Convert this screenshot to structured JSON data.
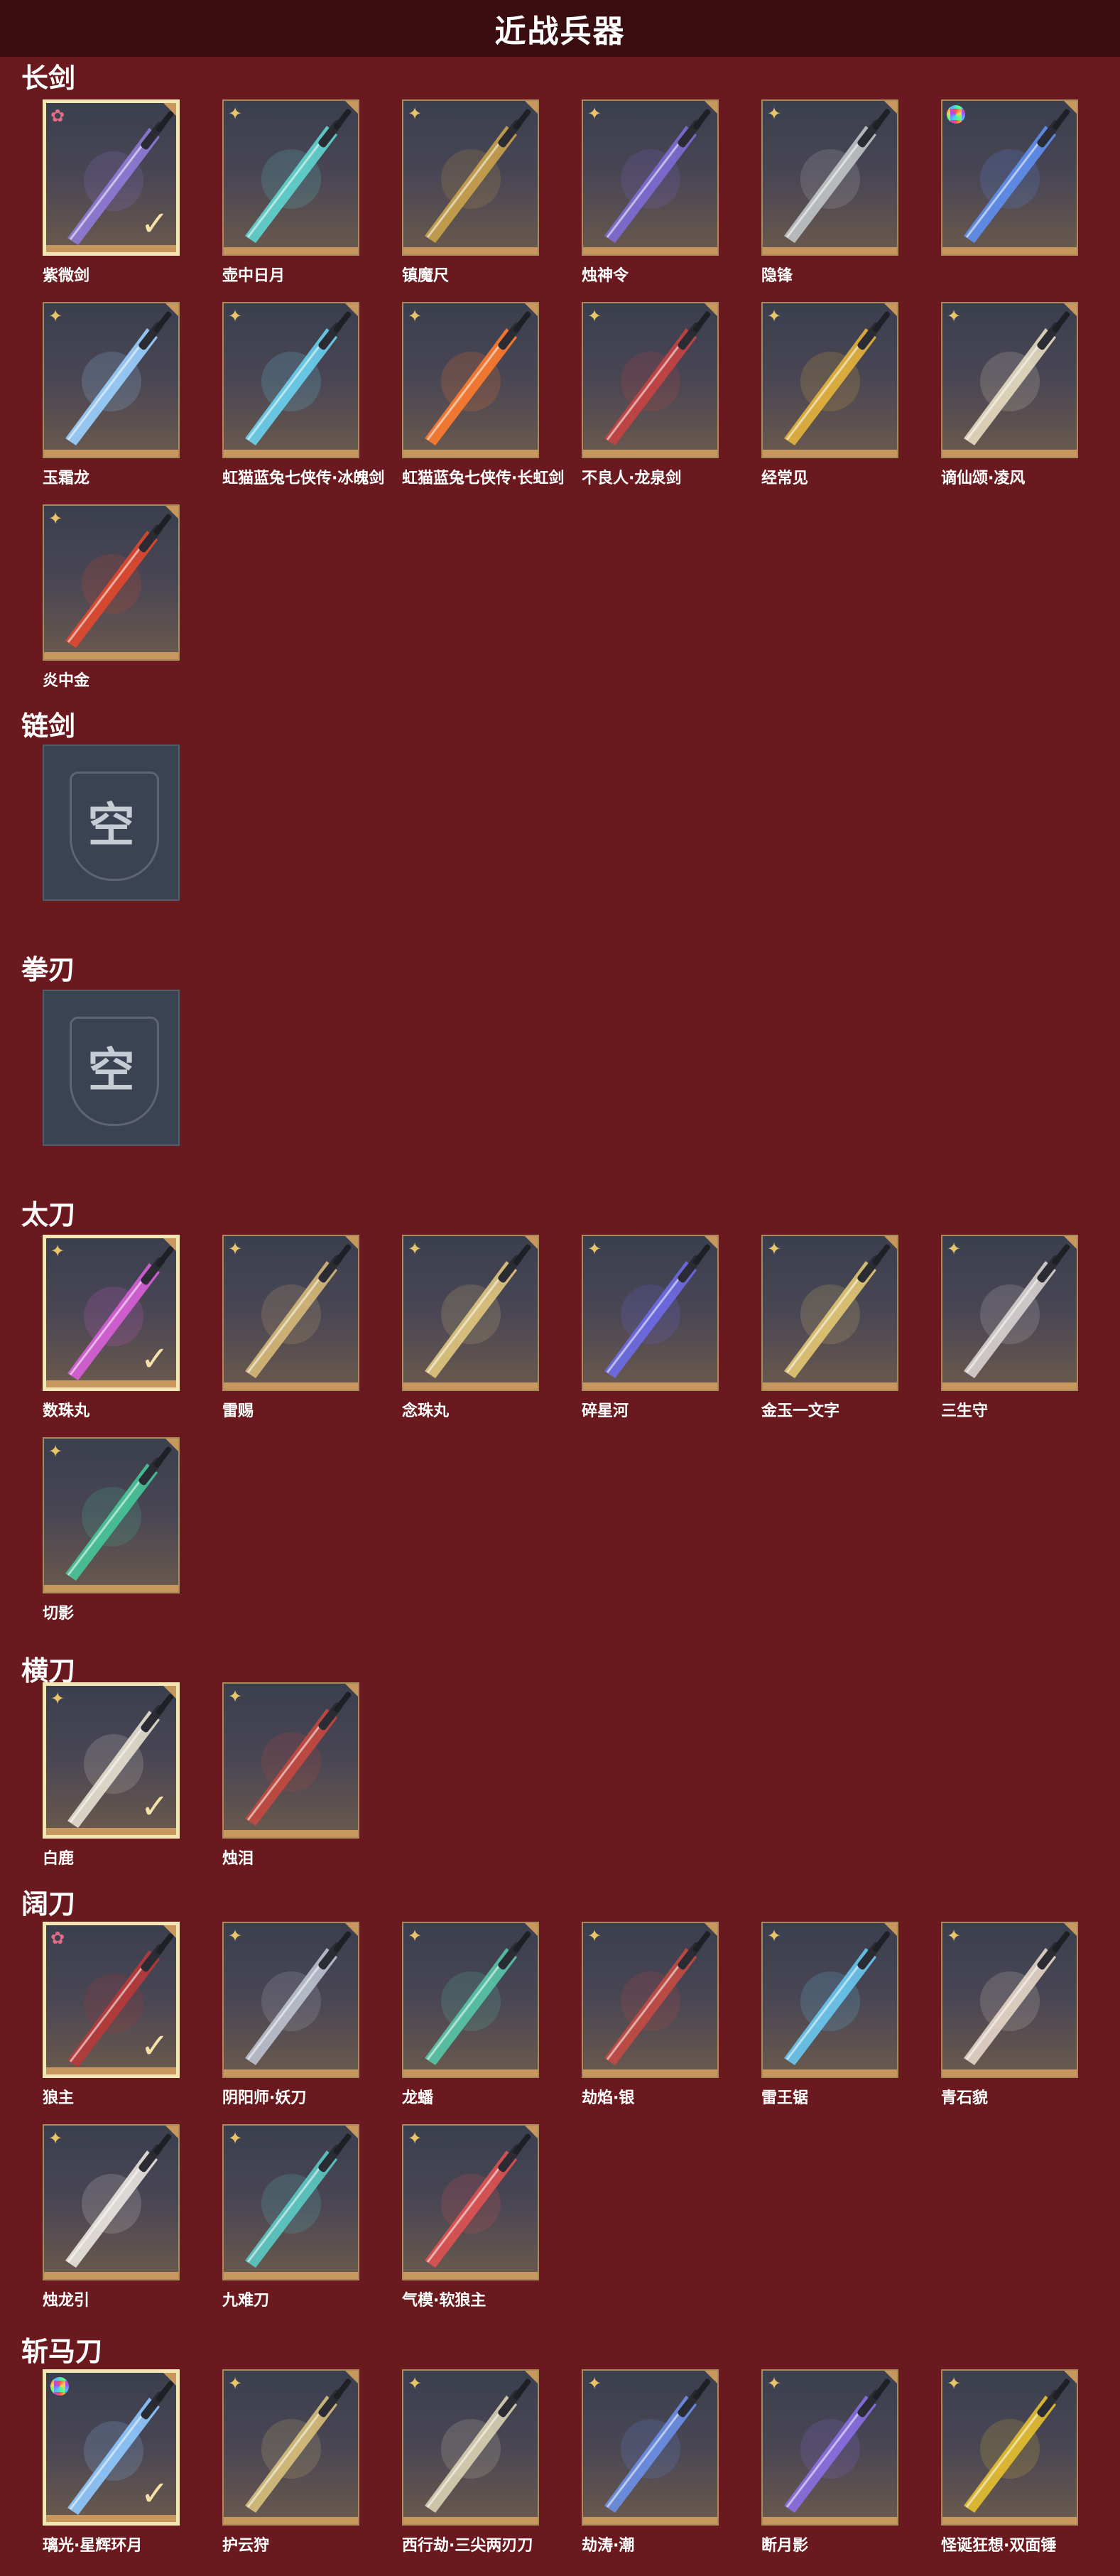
{
  "page": {
    "title": "近战兵器"
  },
  "categories": [
    {
      "name": "长剑",
      "items": [
        {
          "label": "紫微剑",
          "badge": "pink",
          "selected": true,
          "color": "#8f7bd8"
        },
        {
          "label": "壶中日月",
          "badge": "gold",
          "selected": false,
          "color": "#5fd5cf"
        },
        {
          "label": "镇魔尺",
          "badge": "gold",
          "selected": false,
          "color": "#c9a24b"
        },
        {
          "label": "烛神令",
          "badge": "gold",
          "selected": false,
          "color": "#7d6bd4"
        },
        {
          "label": "隐锋",
          "badge": "gold",
          "selected": false,
          "color": "#c0c4c7"
        },
        {
          "label": "",
          "badge": "rainbow",
          "selected": false,
          "color": "#5f8ff0"
        },
        {
          "label": "玉霜龙",
          "badge": "gold",
          "selected": false,
          "color": "#9bd0ff"
        },
        {
          "label": "虹猫蓝兔七侠传·冰魄剑",
          "badge": "gold",
          "selected": false,
          "color": "#6ad1ee"
        },
        {
          "label": "虹猫蓝兔七侠传·长虹剑",
          "badge": "gold",
          "selected": false,
          "color": "#ff7b2d"
        },
        {
          "label": "不良人·龙泉剑",
          "badge": "gold",
          "selected": false,
          "color": "#c74342"
        },
        {
          "label": "经常见",
          "badge": "gold",
          "selected": false,
          "color": "#e6b43c"
        },
        {
          "label": "谪仙颂·凌风",
          "badge": "gold",
          "selected": false,
          "color": "#e7dcc0"
        },
        {
          "label": "炎中金",
          "badge": "gold",
          "selected": false,
          "color": "#e0482e"
        }
      ]
    },
    {
      "name": "链剑",
      "items": [
        {
          "label": "",
          "empty": true,
          "empty_text": "空"
        }
      ]
    },
    {
      "name": "拳刃",
      "items": [
        {
          "label": "",
          "empty": true,
          "empty_text": "空"
        }
      ]
    },
    {
      "name": "太刀",
      "items": [
        {
          "label": "数珠丸",
          "badge": "gold",
          "selected": true,
          "color": "#d85fd8"
        },
        {
          "label": "雷赐",
          "badge": "gold",
          "selected": false,
          "color": "#d6b978"
        },
        {
          "label": "念珠丸",
          "badge": "gold",
          "selected": false,
          "color": "#e0c67e"
        },
        {
          "label": "碎星河",
          "badge": "gold",
          "selected": false,
          "color": "#6d6ae6"
        },
        {
          "label": "金玉一文字",
          "badge": "gold",
          "selected": false,
          "color": "#e2c873"
        },
        {
          "label": "三生守",
          "badge": "gold",
          "selected": false,
          "color": "#d8d2d0"
        },
        {
          "label": "切影",
          "badge": "gold",
          "selected": false,
          "color": "#47c79a"
        }
      ]
    },
    {
      "name": "横刀",
      "items": [
        {
          "label": "白鹿",
          "badge": "gold",
          "selected": true,
          "color": "#e6e0cf"
        },
        {
          "label": "烛泪",
          "badge": "gold",
          "selected": false,
          "color": "#c4493f"
        }
      ]
    },
    {
      "name": "阔刀",
      "items": [
        {
          "label": "狼主",
          "badge": "pink",
          "selected": true,
          "color": "#b83a3a"
        },
        {
          "label": "阴阳师·妖刀",
          "badge": "gold",
          "selected": false,
          "color": "#bcc2cf"
        },
        {
          "label": "龙蟠",
          "badge": "gold",
          "selected": false,
          "color": "#57c6a9"
        },
        {
          "label": "劫焰·银",
          "badge": "gold",
          "selected": false,
          "color": "#c44a43"
        },
        {
          "label": "雷王锯",
          "badge": "gold",
          "selected": false,
          "color": "#69c8ef"
        },
        {
          "label": "青石貌",
          "badge": "gold",
          "selected": false,
          "color": "#e6d6c8"
        },
        {
          "label": "烛龙引",
          "badge": "gold",
          "selected": false,
          "color": "#ebe6e0"
        },
        {
          "label": "九难刀",
          "badge": "gold",
          "selected": false,
          "color": "#5ccac4"
        },
        {
          "label": "气模·软狼主",
          "badge": "gold",
          "selected": false,
          "color": "#df5252"
        }
      ]
    },
    {
      "name": "斩马刀",
      "items": [
        {
          "label": "璃光·星辉环月",
          "badge": "rainbow",
          "selected": true,
          "color": "#8fc9ff"
        },
        {
          "label": "护云狩",
          "badge": "gold",
          "selected": false,
          "color": "#d7c07b"
        },
        {
          "label": "西行劫·三尖两刃刀",
          "badge": "gold",
          "selected": false,
          "color": "#d9d1b3"
        },
        {
          "label": "劫涛·潮",
          "badge": "gold",
          "selected": false,
          "color": "#6c8fe6"
        },
        {
          "label": "断月影",
          "badge": "gold",
          "selected": false,
          "color": "#8a6fe2"
        },
        {
          "label": "怪诞狂想·双面锤",
          "badge": "gold",
          "selected": false,
          "color": "#e6c030"
        }
      ]
    }
  ]
}
